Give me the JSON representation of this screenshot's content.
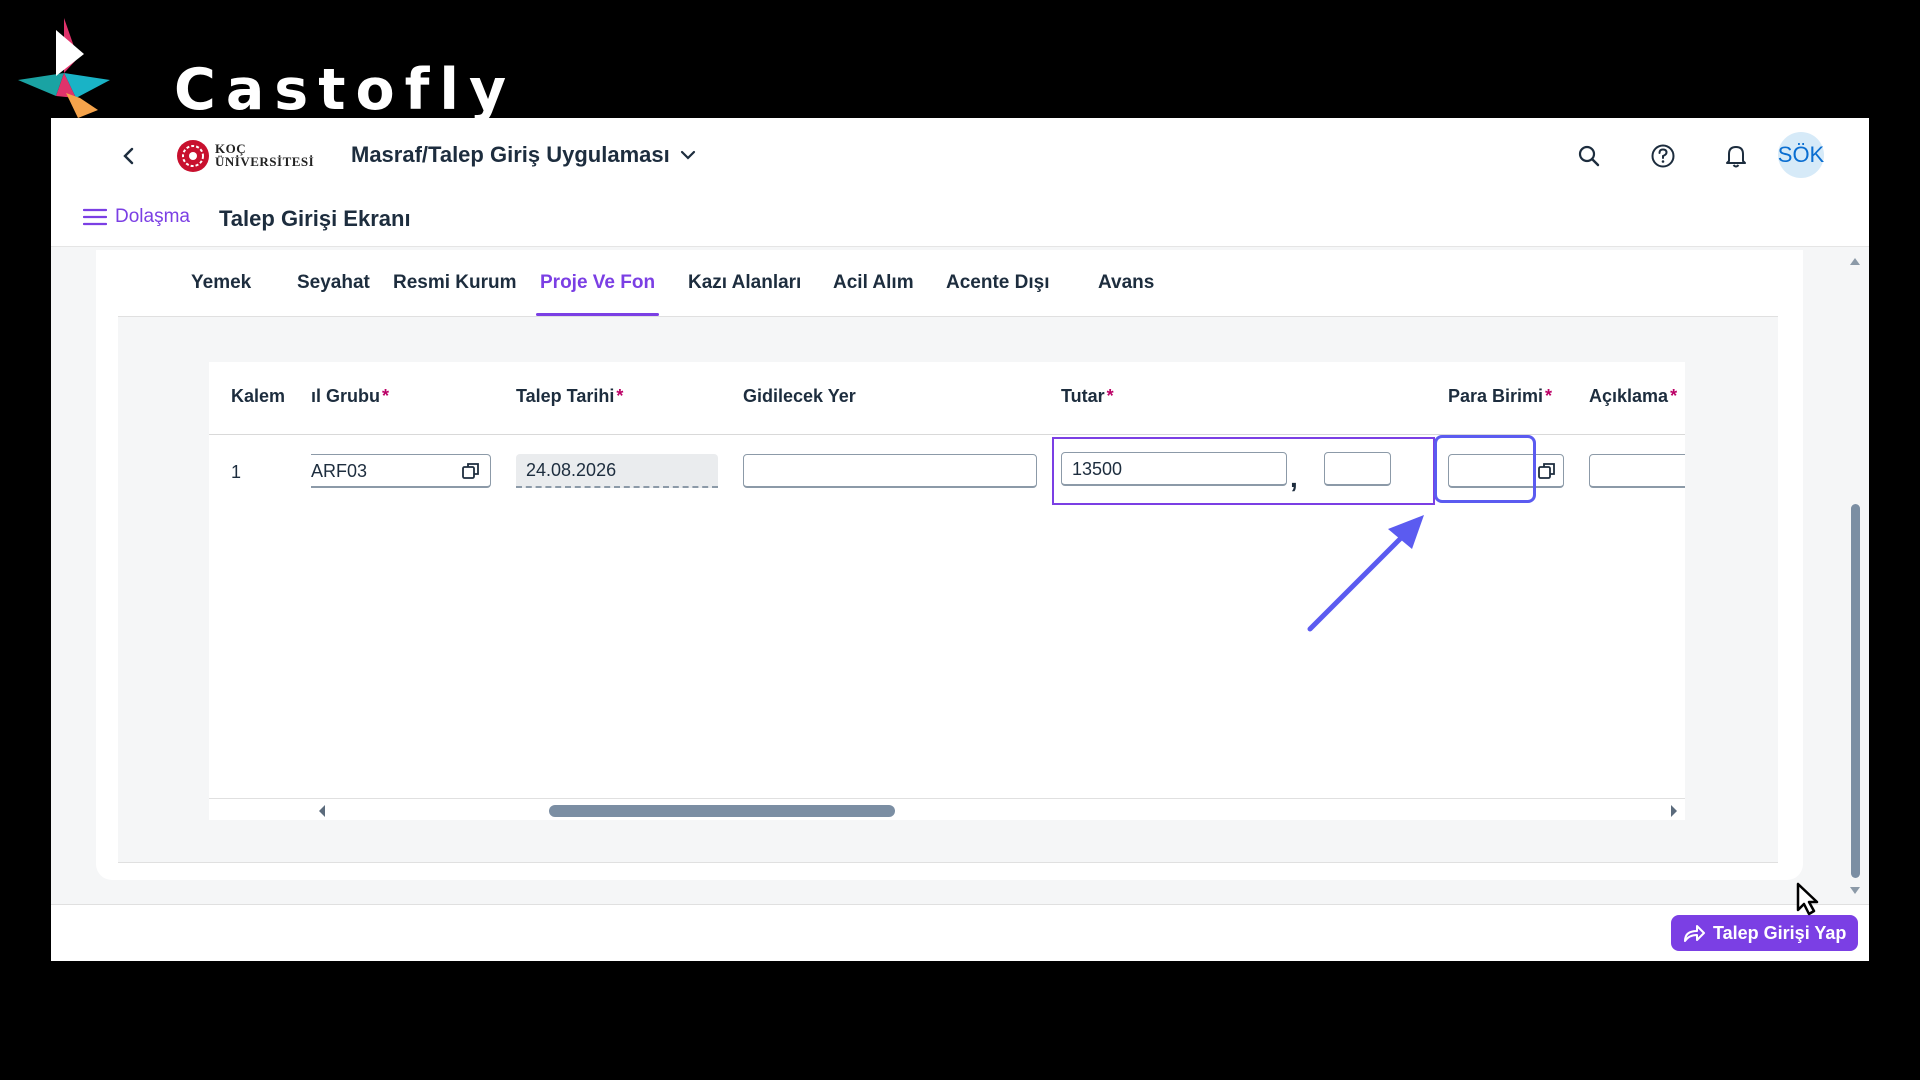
{
  "watermark": {
    "brand_name": "Castofly"
  },
  "shell": {
    "logo_line1": "KOÇ",
    "logo_line2": "ÜNİVERSİTESİ",
    "app_title": "Masraf/Talep Giriş Uygulaması",
    "user_initials": "SÖK",
    "nav_label": "Dolaşma",
    "page_title": "Talep Girişi Ekranı"
  },
  "tabs": [
    {
      "label": "Yemek",
      "active": false
    },
    {
      "label": "Seyahat",
      "active": false
    },
    {
      "label": "Resmi Kurum",
      "active": false
    },
    {
      "label": "Proje Ve Fon",
      "active": true
    },
    {
      "label": "Kazı Alanları",
      "active": false
    },
    {
      "label": "Acil Alım",
      "active": false
    },
    {
      "label": "Acente Dışı",
      "active": false
    },
    {
      "label": "Avans",
      "active": false
    }
  ],
  "table": {
    "columns": [
      {
        "label": "Kalem",
        "required": false
      },
      {
        "label": "ıl Grubu",
        "required": true
      },
      {
        "label": "Talep Tarihi",
        "required": true
      },
      {
        "label": "Gidilecek Yer",
        "required": false
      },
      {
        "label": "Tutar",
        "required": true
      },
      {
        "label": "Para Birimi",
        "required": true
      },
      {
        "label": "Açıklama",
        "required": true
      }
    ],
    "rows": [
      {
        "kalem": "1",
        "grubu": "ARF03",
        "talep_tarihi": "24.08.2026",
        "gidilecek_yer": "",
        "tutar_integer": "13500",
        "tutar_decimal": "",
        "tutar_separator": ",",
        "para_birimi": "",
        "aciklama": ""
      }
    ]
  },
  "footer": {
    "submit_label": "Talep Girişi Yap"
  },
  "colors": {
    "accent": "#7b3fe4",
    "required": "#bb0066",
    "annotation": "#5b5bf0"
  }
}
